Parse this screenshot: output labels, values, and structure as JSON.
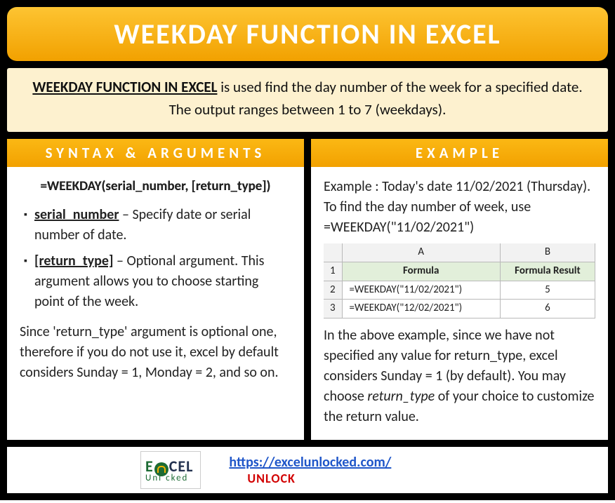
{
  "title": "WEEKDAY FUNCTION IN EXCEL",
  "desc_bold": "WEEKDAY FUNCTION IN EXCEL",
  "desc_rest": " is used find the day number of the week for a specified date. The output ranges between 1 to 7 (weekdays).",
  "left": {
    "header": "SYNTAX & ARGUMENTS",
    "syntax": "=WEEKDAY(serial_number, [return_type])",
    "arg1_label": "serial_number",
    "arg1_text": " – Specify date or serial number of date.",
    "arg2_label": "[return_type]",
    "arg2_text": " – Optional argument. This argument allows you to choose starting point of the week.",
    "note": "Since 'return_type' argument is optional one, therefore if you do not use it, excel by default considers Sunday = 1, Monday = 2, and so on."
  },
  "right": {
    "header": "EXAMPLE",
    "intro": "Example : Today's date 11/02/2021 (Thursday). To find the day number of week, use =WEEKDAY(\"11/02/2021\")",
    "colA": "A",
    "colB": "B",
    "h1": "Formula",
    "h2": "Formula Result",
    "rows": [
      {
        "n": "2",
        "formula": "=WEEKDAY(\"11/02/2021\")",
        "result": "5"
      },
      {
        "n": "3",
        "formula": "=WEEKDAY(\"12/02/2021\")",
        "result": "6"
      }
    ],
    "r1": "1",
    "outro1": "In the above example, since we have not specified any value for return_type, excel considers Sunday = 1 (by default). You may choose ",
    "outro_em": "return_type",
    "outro2": " of your choice to customize the return value."
  },
  "footer": {
    "logo_line1a": "E",
    "logo_line1b": "CEL",
    "logo_line2": "Unl   cked",
    "url": "https://excelunlocked.com/",
    "unlock": "UNLOCK"
  }
}
